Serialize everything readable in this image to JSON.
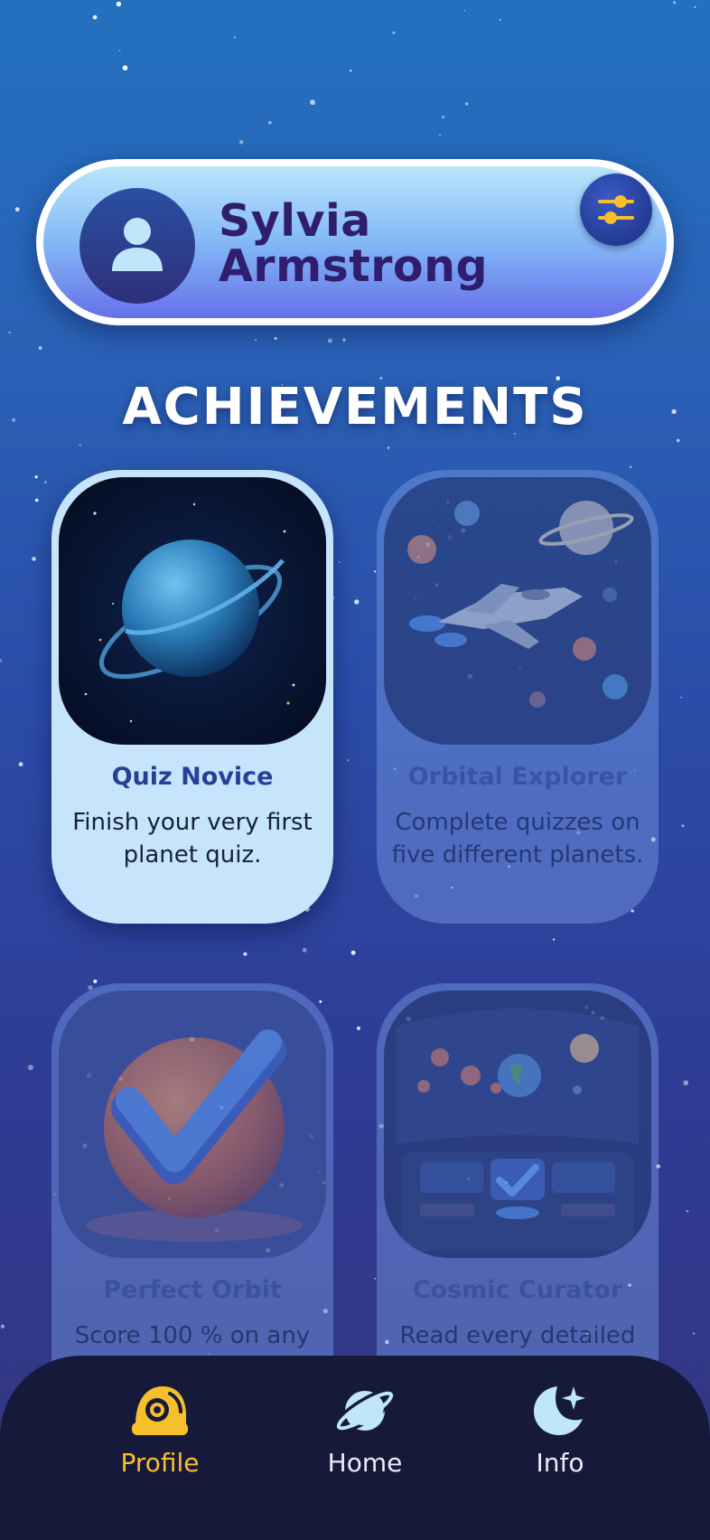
{
  "profile": {
    "name": "Sylvia Armstrong",
    "avatar_icon": "user-icon",
    "settings_icon": "sliders-icon"
  },
  "section_title": "ACHIEVEMENTS",
  "achievements": [
    {
      "title": "Quiz Novice",
      "description": "Finish your very first planet quiz.",
      "status": "earned",
      "art": "ringed-planet"
    },
    {
      "title": "Orbital Explorer",
      "description": "Complete quizzes on five different planets.",
      "status": "locked",
      "art": "spaceship-planets"
    },
    {
      "title": "Perfect Orbit",
      "description": "Score 100 % on any",
      "status": "locked",
      "art": "planet-checkmark"
    },
    {
      "title": "Cosmic Curator",
      "description": "Read every detailed",
      "status": "locked",
      "art": "cockpit-checkmark"
    }
  ],
  "nav": {
    "items": [
      {
        "label": "Profile",
        "icon": "astronaut-helmet-icon",
        "active": true
      },
      {
        "label": "Home",
        "icon": "planet-icon",
        "active": false
      },
      {
        "label": "Info",
        "icon": "moon-star-icon",
        "active": false
      }
    ]
  },
  "colors": {
    "background_top": "#2370bf",
    "background_bottom": "#33357e",
    "accent": "#f6bf2c",
    "nav_background": "#17193a",
    "name_text": "#2f1d6d"
  }
}
